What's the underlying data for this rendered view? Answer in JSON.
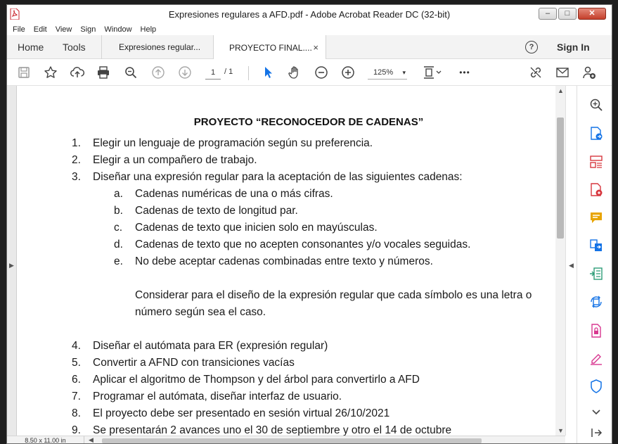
{
  "window": {
    "title": "Expresiones regulares a AFD.pdf - Adobe Acrobat Reader DC (32-bit)",
    "buttons": {
      "minimize": "–",
      "maximize": "□",
      "close": "✕"
    }
  },
  "menu": [
    "File",
    "Edit",
    "View",
    "Sign",
    "Window",
    "Help"
  ],
  "tabs": {
    "home": "Home",
    "tools": "Tools",
    "doc_tabs": [
      {
        "label": "Expresiones regular..."
      },
      {
        "label": "PROYECTO FINAL....",
        "close": "×"
      }
    ],
    "help": "?",
    "sign_in": "Sign In"
  },
  "toolbar": {
    "page_current": "1",
    "page_total": "/ 1",
    "zoom": "125%",
    "zoom_arrow": "▾",
    "more": "•••"
  },
  "document": {
    "title": "PROYECTO “RECONOCEDOR DE CADENAS”",
    "items": [
      {
        "num": "1.",
        "text": "Elegir un lenguaje de programación según su preferencia."
      },
      {
        "num": "2.",
        "text": "Elegir a un compañero de trabajo."
      },
      {
        "num": "3.",
        "text": "Diseñar una expresión regular para la aceptación de las siguientes cadenas:"
      }
    ],
    "subitems": [
      {
        "num": "a.",
        "text": "Cadenas numéricas de una o más cifras."
      },
      {
        "num": "b.",
        "text": "Cadenas de texto de longitud par."
      },
      {
        "num": "c.",
        "text": "Cadenas de texto que inicien solo en mayúsculas."
      },
      {
        "num": "d.",
        "text": "Cadenas de texto que no acepten consonantes y/o vocales seguidas."
      },
      {
        "num": "e.",
        "text": "No debe aceptar cadenas combinadas entre texto y números."
      }
    ],
    "note_line1": "Considerar para el diseño de la expresión regular que cada símbolo es una letra o",
    "note_line2": "número según sea el caso.",
    "items2": [
      {
        "num": "4.",
        "text": "Diseñar el autómata para ER (expresión regular)"
      },
      {
        "num": "5.",
        "text": "Convertir a AFND con transiciones vacías"
      },
      {
        "num": "6.",
        "text": "Aplicar el algoritmo de Thompson y del árbol para convertirlo a AFD"
      },
      {
        "num": "7.",
        "text": "Programar el autómata, diseñar interfaz de usuario."
      },
      {
        "num": "8.",
        "text": "El proyecto debe ser presentado en sesión virtual 26/10/2021"
      },
      {
        "num": "9.",
        "text": "Se presentarán 2 avances uno el 30 de septiembre y otro el 14 de octubre"
      }
    ]
  },
  "status": {
    "page_size": "8.50 x 11.00 in"
  },
  "colors": {
    "accent_blue": "#1473e6",
    "tool_red": "#d7373f",
    "tool_purple": "#9b3bbd",
    "tool_yellow": "#e8a400",
    "tool_green": "#2d9d78",
    "tool_pink": "#d83790"
  }
}
